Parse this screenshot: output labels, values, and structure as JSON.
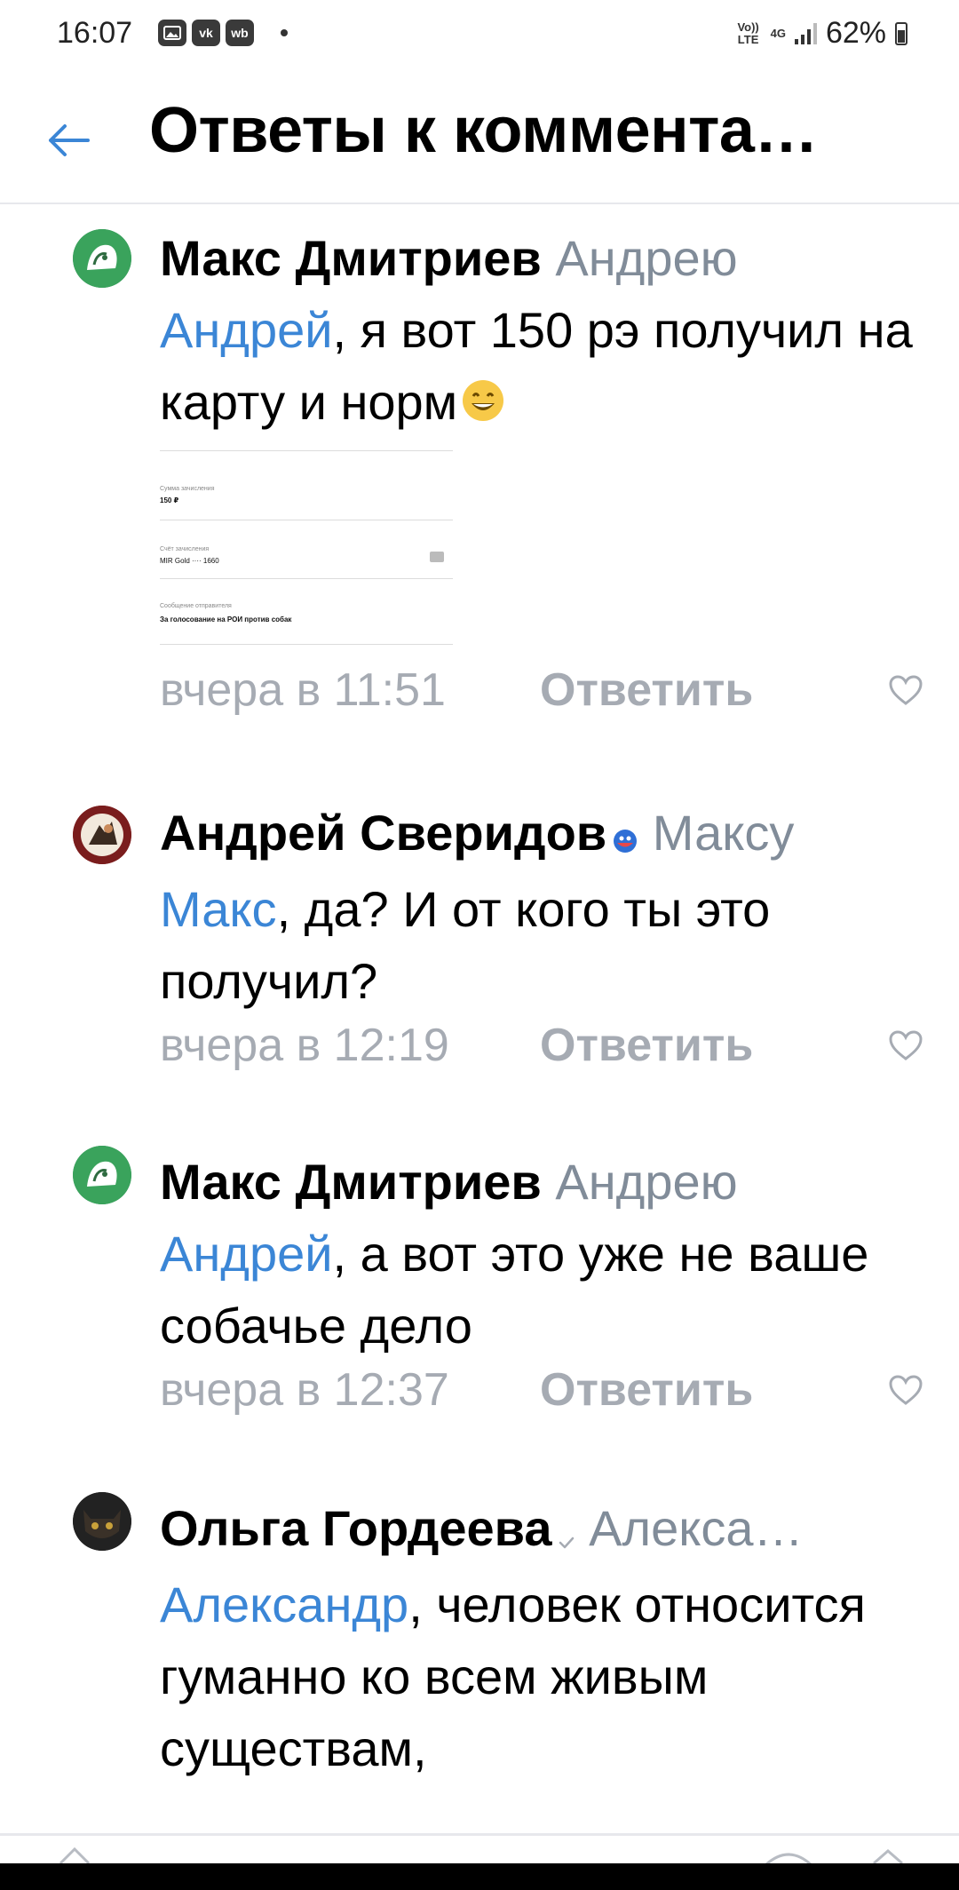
{
  "status_bar": {
    "time": "16:07",
    "left_badges": [
      "vk",
      "wb"
    ],
    "network_small_1": "Vo)) LTE",
    "network_small_2": "4G",
    "battery": "62%"
  },
  "header": {
    "title": "Ответы к коммента…",
    "back_icon": "arrow-left-icon"
  },
  "comments": [
    {
      "author": "Макс Дмитриев",
      "reply_to": "Андрею",
      "mention": "Андрей",
      "text": ", я вот 150 рэ получил на карту и норм",
      "emoji": "smile-emoji",
      "time": "вчера в 11:51",
      "reply_label": "Ответить",
      "attachment": {
        "rows": [
          {
            "label": "Сумма зачисления",
            "value": "150 ₽"
          },
          {
            "label": "Счёт зачисления",
            "value": "MIR Gold ···· 1660"
          },
          {
            "label": "Сообщение отправителя",
            "value": "За голосование на РОИ против собак"
          }
        ]
      }
    },
    {
      "author": "Андрей Сверидов",
      "reply_to": "Максу",
      "mention": "Макс",
      "text": ", да? И от кого ты это получил?",
      "time": "вчера в 12:19",
      "reply_label": "Ответить"
    },
    {
      "author": "Макс Дмитриев",
      "reply_to": "Андрею",
      "mention": "Андрей",
      "text": ", а вот это уже не ваше собачье дело",
      "time": "вчера в 12:37",
      "reply_label": "Ответить"
    },
    {
      "author": "Ольга Гордеева",
      "reply_to": "Алекса…",
      "mention": "Александр",
      "text": ", человек относится гуманно ко всем живым существам,"
    }
  ],
  "colors": {
    "accent": "#3b86d6",
    "muted": "#a6abb3",
    "reply_to": "#818c99",
    "divider": "#e7e8ec"
  }
}
